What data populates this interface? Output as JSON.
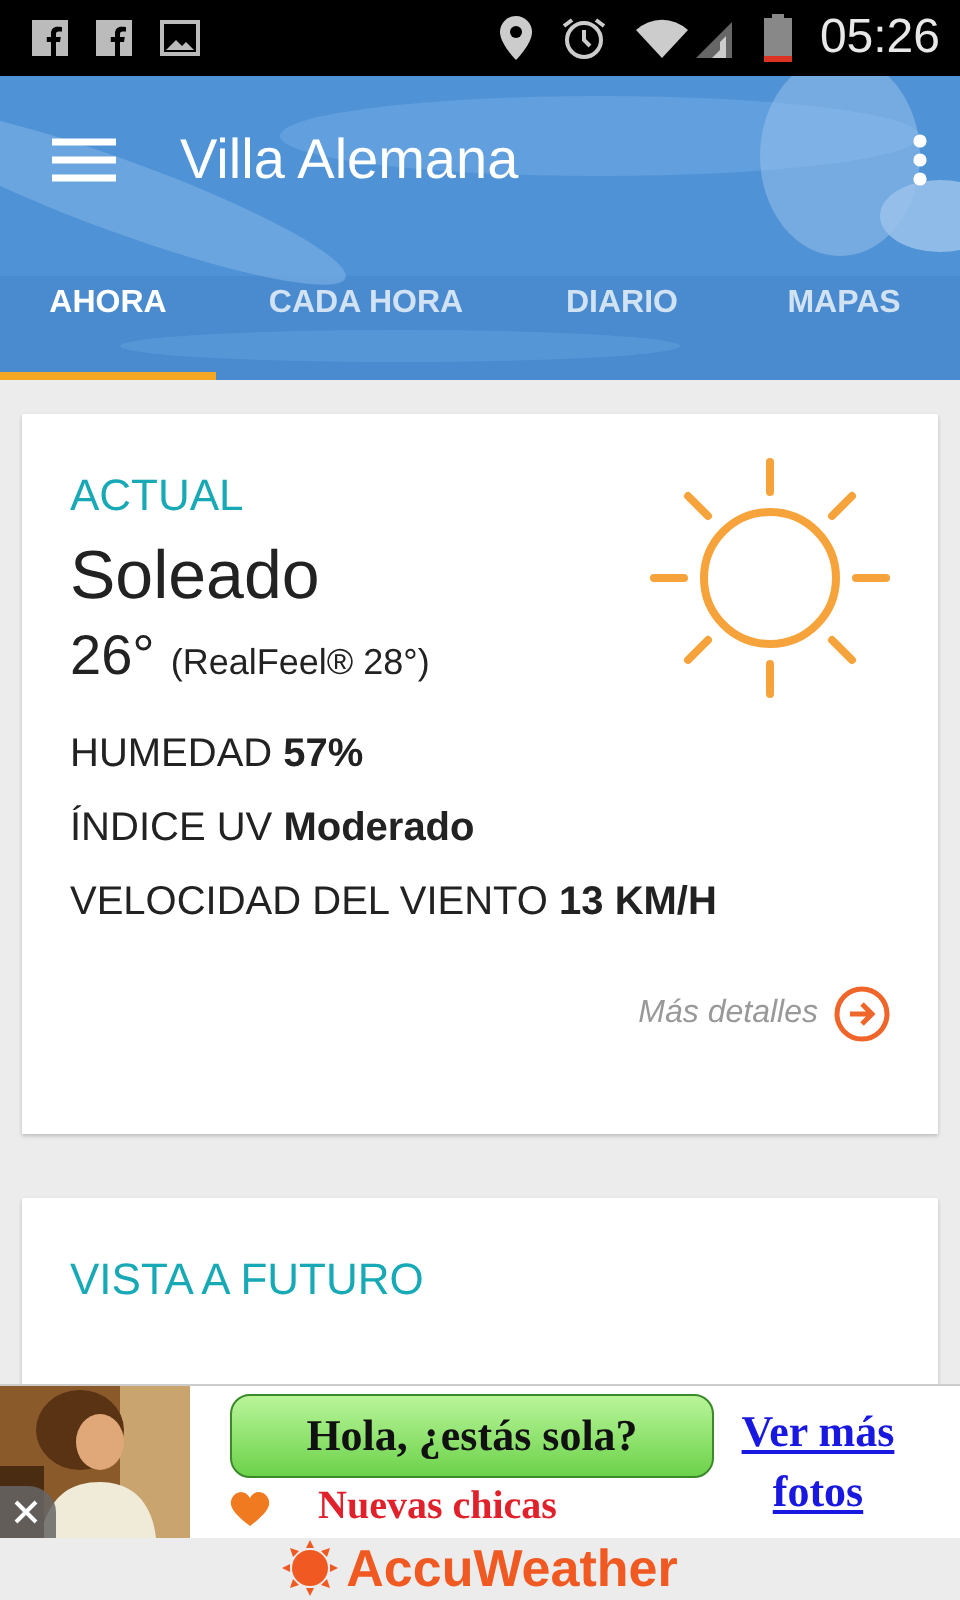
{
  "status_bar": {
    "time": "05:26"
  },
  "app_bar": {
    "title": "Villa Alemana",
    "tabs": [
      {
        "label": "AHORA",
        "selected": true
      },
      {
        "label": "CADA HORA",
        "selected": false
      },
      {
        "label": "DIARIO",
        "selected": false
      },
      {
        "label": "MAPAS",
        "selected": false
      }
    ]
  },
  "current": {
    "heading": "ACTUAL",
    "condition": "Soleado",
    "temperature": "26°",
    "realfeel": "(RealFeel® 28°)",
    "details": [
      "HUMEDAD **57%**",
      "ÍNDICE UV **Moderado**",
      "VELOCIDAD DEL VIENTO **13 KM/H**"
    ],
    "more_link": "Más detalles"
  },
  "forecast": {
    "heading": "VISTA A FUTURO"
  },
  "ad": {
    "kind": "picture",
    "headline": "Hola, ¿estás sola?",
    "subline": "Nuevas chicas",
    "link": "Ver más fotos"
  },
  "footer": {
    "brand": "AccuWeather"
  }
}
